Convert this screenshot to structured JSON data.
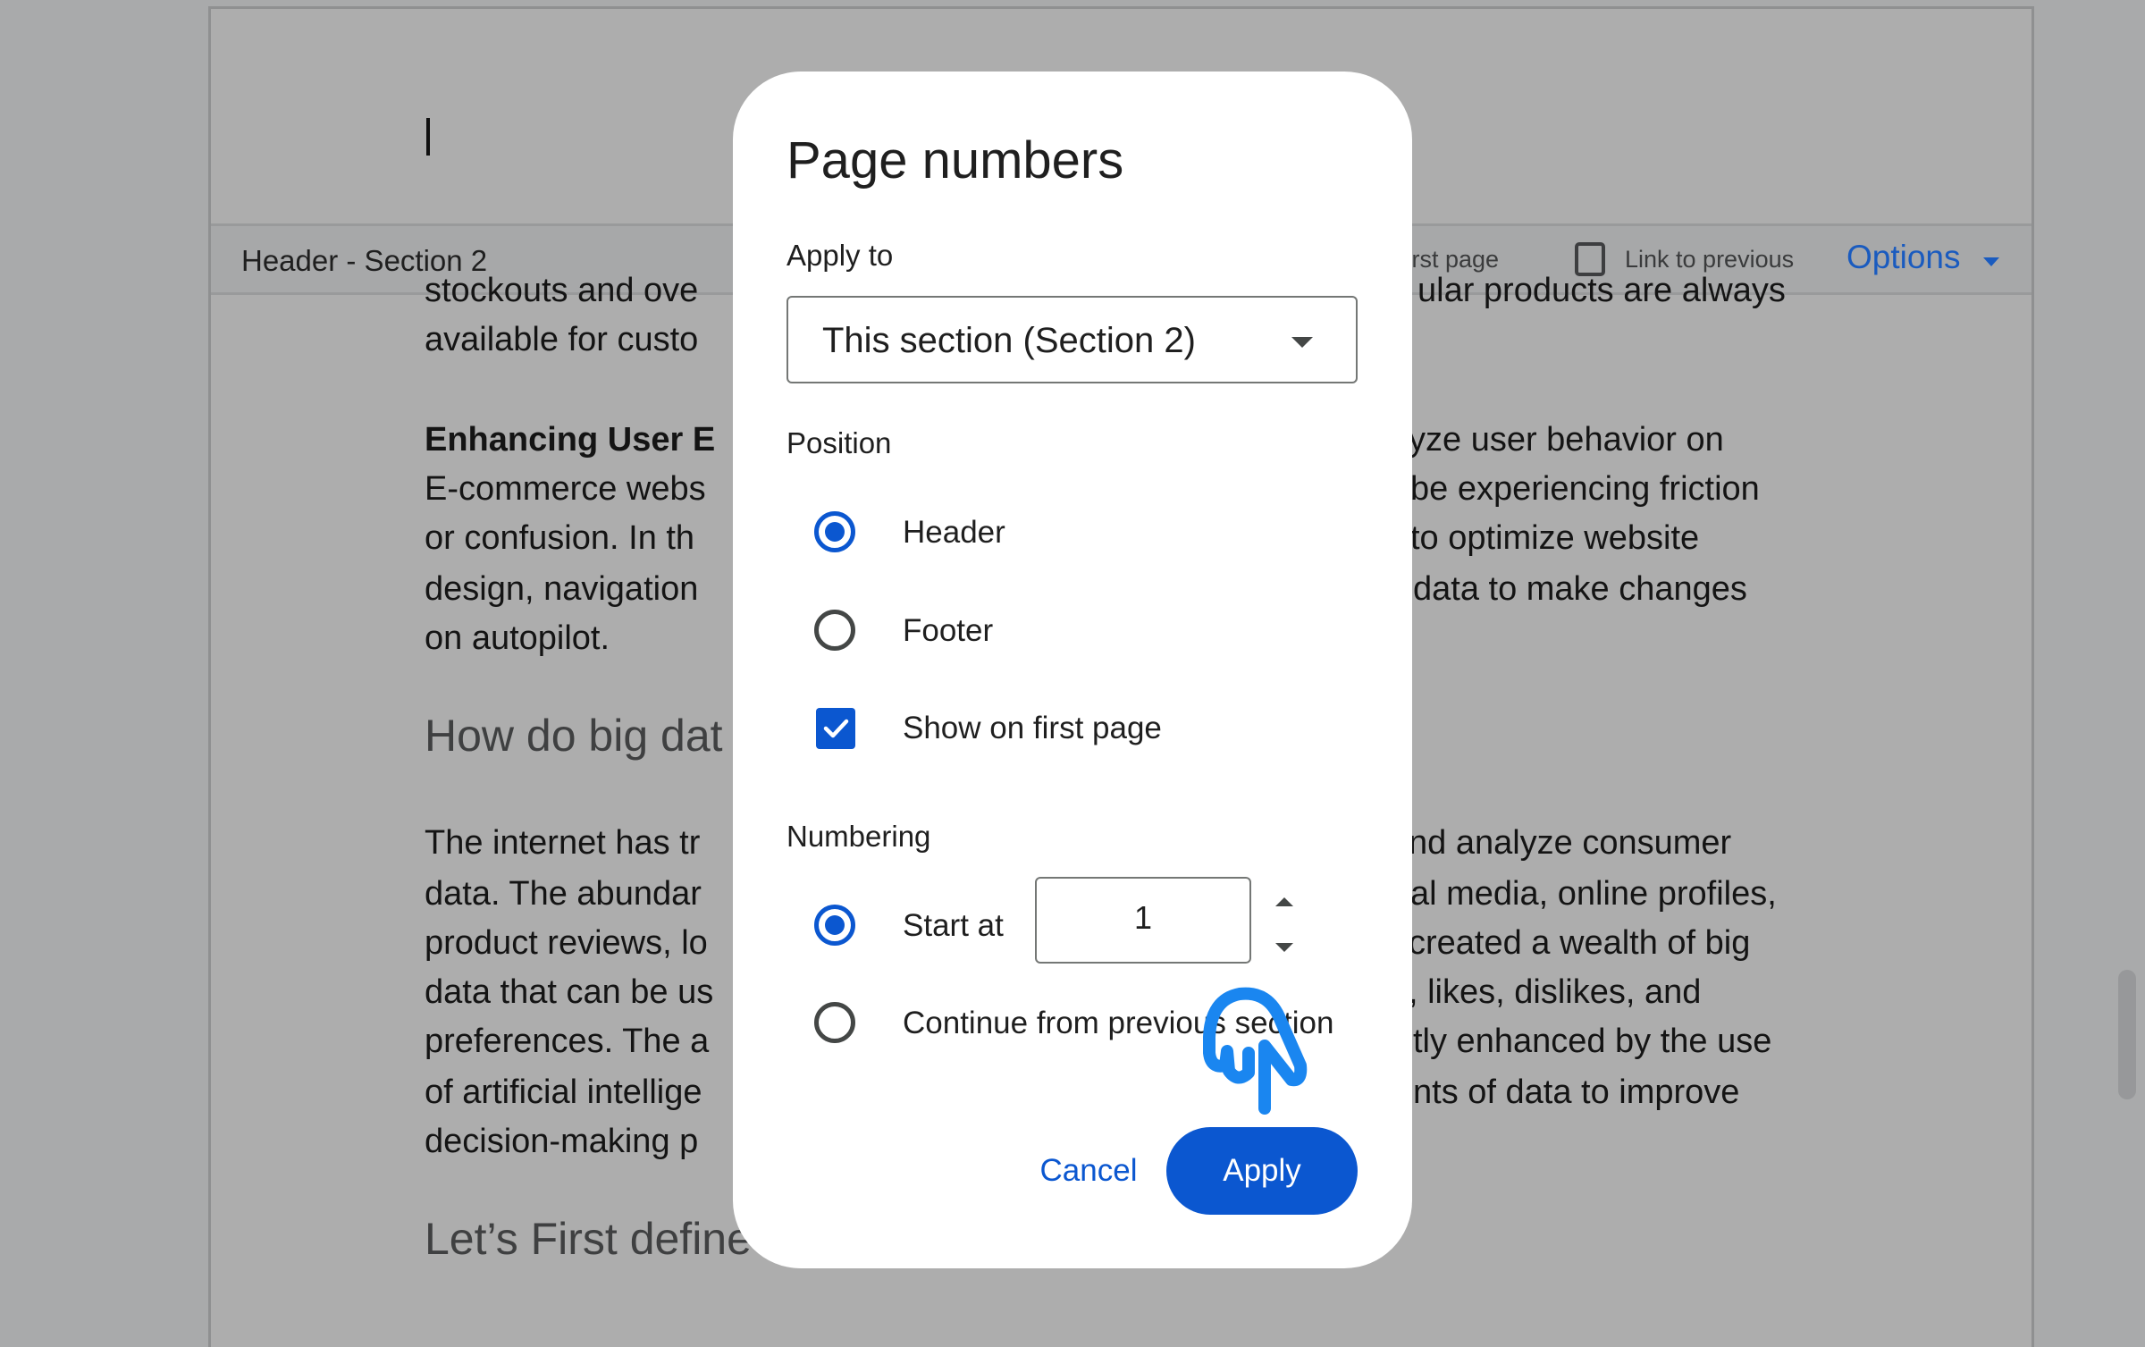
{
  "document": {
    "header_bar": {
      "label": "Header - Section 2",
      "different_first_page_label_visible": "first page",
      "link_to_previous_label": "Link to previous",
      "link_to_previous_checked": false,
      "options_label": "Options"
    },
    "left_column_lines": [
      {
        "text": "stockouts and ove",
        "style": "normal"
      },
      {
        "text": "available for custo",
        "style": "normal"
      },
      {
        "text": "Enhancing User E",
        "style": "bold"
      },
      {
        "text": "E-commerce webs",
        "style": "normal"
      },
      {
        "text": "or confusion. In th",
        "style": "normal"
      },
      {
        "text": "design, navigation",
        "style": "normal"
      },
      {
        "text": "on autopilot.",
        "style": "normal"
      },
      {
        "text": "How do big dat",
        "style": "heading"
      },
      {
        "text": "The internet has tr",
        "style": "normal"
      },
      {
        "text": "data. The abundar",
        "style": "normal"
      },
      {
        "text": "product reviews, lo",
        "style": "normal"
      },
      {
        "text": "data that can be us",
        "style": "normal"
      },
      {
        "text": "preferences. The a",
        "style": "normal"
      },
      {
        "text": "of artificial intellige",
        "style": "normal"
      },
      {
        "text": "decision-making p",
        "style": "normal"
      },
      {
        "text": "Let’s First define",
        "style": "heading"
      }
    ],
    "right_column_lines": [
      "ular products are always",
      "yze user behavior on",
      "be experiencing friction",
      "to optimize website",
      "data to make changes",
      "nd analyze consumer",
      "al media, online profiles,",
      "created a wealth of big",
      ", likes, dislikes, and",
      "tly enhanced by the use",
      "nts of data to improve"
    ]
  },
  "dialog": {
    "title": "Page numbers",
    "apply_to": {
      "label": "Apply to",
      "selected": "This section (Section 2)"
    },
    "position": {
      "label": "Position",
      "options": [
        {
          "label": "Header",
          "selected": true
        },
        {
          "label": "Footer",
          "selected": false
        }
      ],
      "show_on_first_page": {
        "label": "Show on first page",
        "checked": true
      }
    },
    "numbering": {
      "label": "Numbering",
      "start_at": {
        "label": "Start at",
        "selected": true,
        "value": "1"
      },
      "continue": {
        "label": "Continue from previous section",
        "selected": false
      }
    },
    "buttons": {
      "cancel": "Cancel",
      "apply": "Apply"
    }
  },
  "colors": {
    "accent": "#0b57d0",
    "cursor_overlay": "#1a86f0",
    "overlay_bg": "#a9aaab"
  }
}
